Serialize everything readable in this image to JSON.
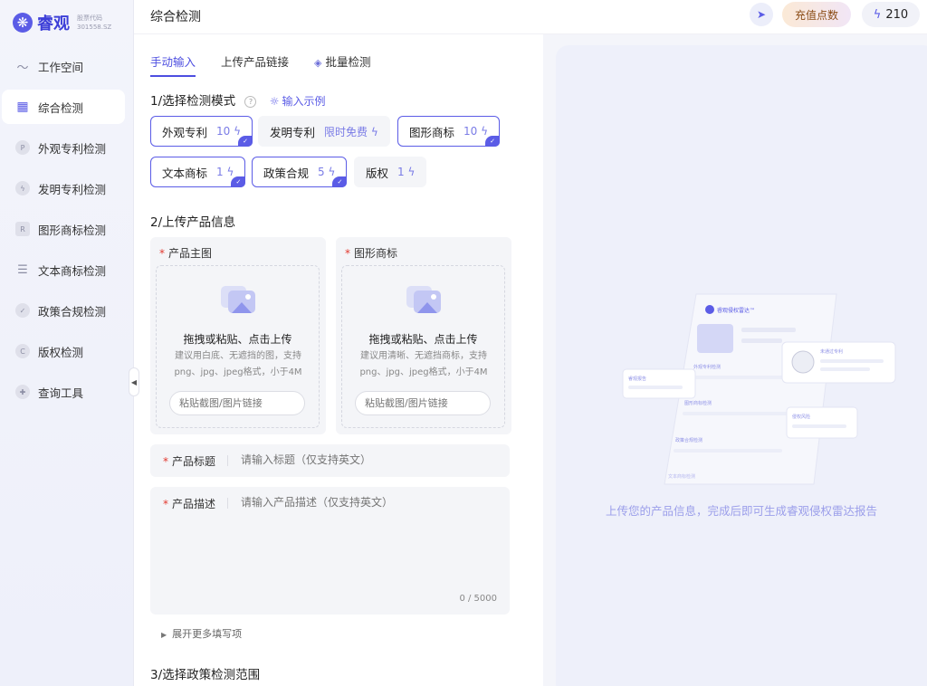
{
  "app": {
    "logo_glyph": "❋",
    "name": "睿观",
    "stock_label": "股票代码",
    "stock_code": "301558.SZ"
  },
  "sidebar": {
    "items": [
      {
        "label": "工作空间",
        "icon": "chart-line-icon",
        "glyph": "〜"
      },
      {
        "label": "综合检测",
        "icon": "grid-plus-icon",
        "glyph": "▦"
      },
      {
        "label": "外观专利检测",
        "icon": "p-circle-icon",
        "glyph": "P"
      },
      {
        "label": "发明专利检测",
        "icon": "bulb-icon",
        "glyph": "ϟ"
      },
      {
        "label": "图形商标检测",
        "icon": "r-circle-icon",
        "glyph": "R"
      },
      {
        "label": "文本商标检测",
        "icon": "document-icon",
        "glyph": "☰"
      },
      {
        "label": "政策合规检测",
        "icon": "shield-check-icon",
        "glyph": "✓"
      },
      {
        "label": "版权检测",
        "icon": "c-circle-icon",
        "glyph": "C"
      },
      {
        "label": "查询工具",
        "icon": "search-plus-icon",
        "glyph": "✚"
      }
    ],
    "collapse_glyph": "◀"
  },
  "topbar": {
    "title": "综合检测",
    "recharge_label": "充值点数",
    "points": "210",
    "bolt_glyph": "ϟ",
    "send_glyph": "➤"
  },
  "tabs": [
    {
      "label": "手动输入"
    },
    {
      "label": "上传产品链接"
    },
    {
      "label": "批量检测",
      "glyph": "◈"
    }
  ],
  "step1": {
    "title": "1/选择检测模式",
    "help_glyph": "?",
    "example_glyph": "☼",
    "example_link": "输入示例"
  },
  "modes": [
    {
      "label": "外观专利",
      "cost": "10 ϟ",
      "selected": true
    },
    {
      "label": "发明专利",
      "cost": "限时免费 ϟ",
      "selected": false
    },
    {
      "label": "图形商标",
      "cost": "10 ϟ",
      "selected": true
    },
    {
      "label": "文本商标",
      "cost": "1 ϟ",
      "selected": true
    },
    {
      "label": "政策合规",
      "cost": "5 ϟ",
      "selected": true
    },
    {
      "label": "版权",
      "cost": "1 ϟ",
      "selected": false
    }
  ],
  "check_glyph": "✓",
  "step2": {
    "title": "2/上传产品信息",
    "required_mark": "*",
    "uploads": [
      {
        "label": "产品主图",
        "main": "拖拽或粘贴、点击上传",
        "hint": "建议用白底、无遮挡的图，支持png、jpg、jpeg格式，小于4M",
        "placeholder": "粘贴截图/图片链接"
      },
      {
        "label": "图形商标",
        "main": "拖拽或粘贴、点击上传",
        "hint": "建议用清晰、无遮挡商标，支持png、jpg、jpeg格式，小于4M",
        "placeholder": "粘贴截图/图片链接"
      }
    ],
    "title_field": {
      "label": "产品标题",
      "placeholder": "请输入标题（仅支持英文）"
    },
    "desc_field": {
      "label": "产品描述",
      "placeholder": "请输入产品描述（仅支持英文）",
      "counter": "0 / 5000"
    },
    "expand_glyph": "▶",
    "expand_label": "展开更多填写项"
  },
  "step3": {
    "title": "3/选择政策检测范围"
  },
  "preview": {
    "caption": "上传您的产品信息，完成后即可生成睿观侵权雷达报告",
    "card_brand": "睿观侵权雷达™",
    "rows": [
      "外观专利检测",
      "图形商标检测",
      "政策合规检测",
      "文本商标检测"
    ],
    "float_left": "睿观报告",
    "float_right": "未通过专利",
    "float_bottom": "侵权风险"
  },
  "colors": {
    "accent": "#5b5ce6",
    "required": "#e2392f",
    "recharge_text": "#8a4b14"
  }
}
